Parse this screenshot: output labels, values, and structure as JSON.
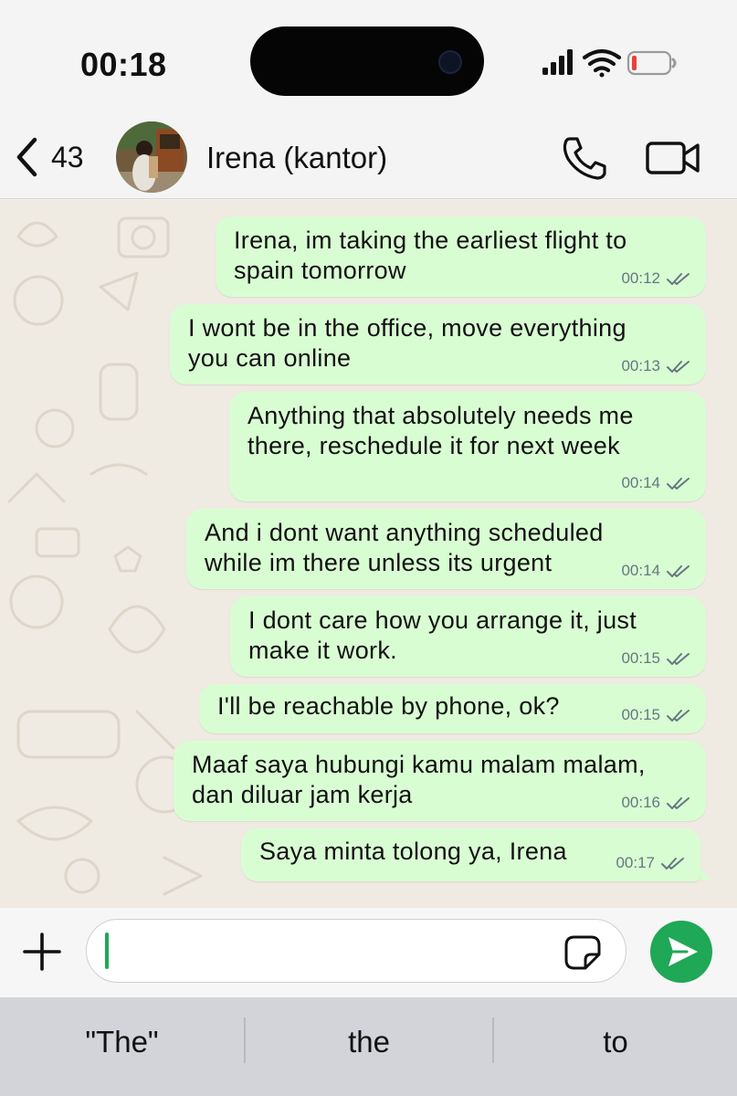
{
  "status_bar": {
    "time": "00:18",
    "icons": [
      "cellular-signal-icon",
      "wifi-icon",
      "battery-low-icon"
    ]
  },
  "header": {
    "back_count": "43",
    "contact_name": "Irena (kantor)",
    "actions": [
      "phone-icon",
      "video-camera-icon"
    ]
  },
  "messages": [
    {
      "lines": [
        "Irena, im taking the earliest flight to",
        "spain tomorrow"
      ],
      "time": "00:12",
      "status": "read"
    },
    {
      "lines": [
        "I wont be in the office, move everything",
        "you can online"
      ],
      "time": "00:13",
      "status": "read"
    },
    {
      "lines": [
        "Anything that absolutely needs me",
        "there, reschedule it for next week"
      ],
      "time": "00:14",
      "status": "read"
    },
    {
      "lines": [
        "And i dont want anything scheduled",
        "while im there unless its urgent"
      ],
      "time": "00:14",
      "status": "read"
    },
    {
      "lines": [
        "I dont care how you arrange it, just",
        "make it work."
      ],
      "time": "00:15",
      "status": "read"
    },
    {
      "lines": [
        "I'll be reachable by phone, ok?"
      ],
      "time": "00:15",
      "status": "read"
    },
    {
      "lines": [
        "Maaf saya hubungi kamu malam malam,",
        "dan diluar jam kerja"
      ],
      "time": "00:16",
      "status": "read"
    },
    {
      "lines": [
        "Saya minta tolong ya, Irena"
      ],
      "time": "00:17",
      "status": "read"
    }
  ],
  "composer": {
    "value": "",
    "icons": [
      "plus-icon",
      "sticker-icon",
      "send-icon"
    ]
  },
  "keyboard_suggestions": [
    "\"The\"",
    "the",
    "to"
  ],
  "colors": {
    "outgoing_bubble": "#d9fdd3",
    "accent_green": "#1fa855",
    "chat_background": "#efeae2",
    "read_ticks": "#667781"
  }
}
